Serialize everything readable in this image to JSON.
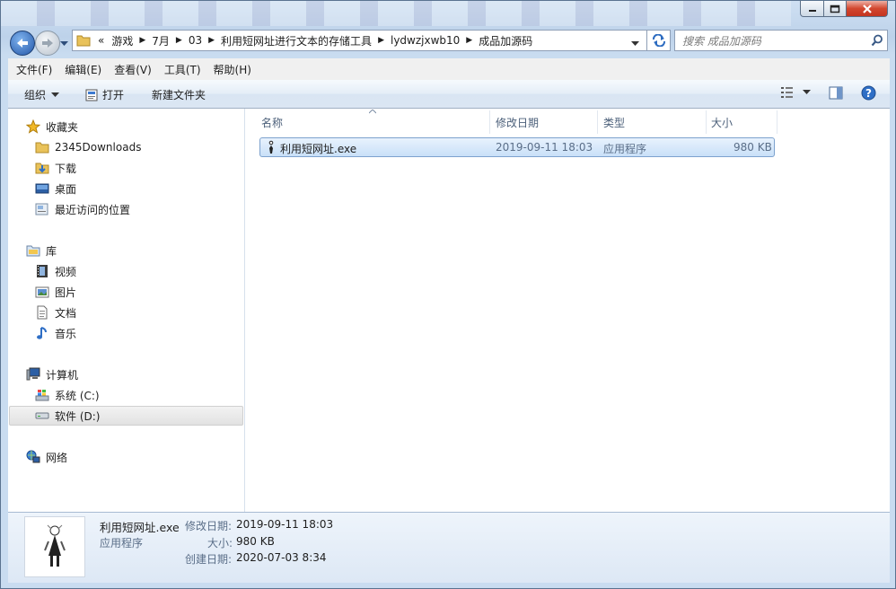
{
  "window": {
    "caption_buttons": [
      "minimize-icon",
      "maximize-icon",
      "close-icon"
    ]
  },
  "address_bar": {
    "overflow": "«",
    "crumbs": [
      "游戏",
      "7月",
      "03",
      "利用短网址进行文本的存储工具",
      "lydwzjxwb10",
      "成品加源码"
    ]
  },
  "search": {
    "placeholder": "搜索 成品加源码"
  },
  "menu": [
    "文件(F)",
    "编辑(E)",
    "查看(V)",
    "工具(T)",
    "帮助(H)"
  ],
  "toolbar": {
    "organize": "组织",
    "open": "打开",
    "new_folder": "新建文件夹"
  },
  "nav_pane": {
    "favorites": {
      "label": "收藏夹",
      "items": [
        "2345Downloads",
        "下载",
        "桌面",
        "最近访问的位置"
      ]
    },
    "libraries": {
      "label": "库",
      "items": [
        "视频",
        "图片",
        "文档",
        "音乐"
      ]
    },
    "computer": {
      "label": "计算机",
      "items": [
        "系统 (C:)",
        "软件 (D:)"
      ],
      "selected": "软件 (D:)"
    },
    "network": {
      "label": "网络"
    }
  },
  "columns": [
    "名称",
    "修改日期",
    "类型",
    "大小"
  ],
  "files": [
    {
      "name": "利用短网址.exe",
      "modified": "2019-09-11 18:03",
      "type": "应用程序",
      "size": "980 KB"
    }
  ],
  "details": {
    "filename": "利用短网址.exe",
    "type": "应用程序",
    "modified_label": "修改日期:",
    "modified": "2019-09-11 18:03",
    "size_label": "大小:",
    "size": "980 KB",
    "created_label": "创建日期:",
    "created": "2020-07-03 8:34"
  },
  "colors": {
    "selection": "#cce4f7",
    "accent": "#3a6ea5"
  }
}
